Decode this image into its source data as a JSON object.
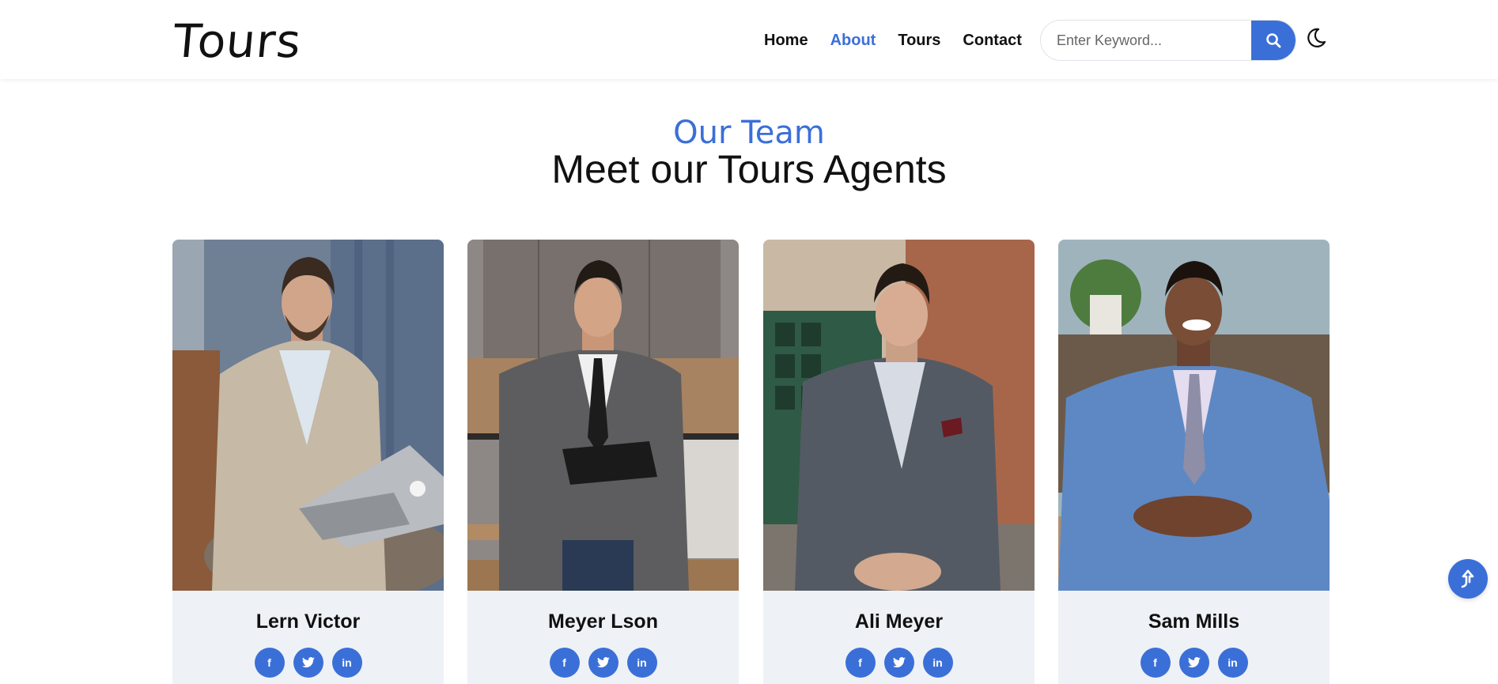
{
  "brand": {
    "logo": "Tours"
  },
  "nav": {
    "items": [
      {
        "label": "Home",
        "active": false
      },
      {
        "label": "About",
        "active": true
      },
      {
        "label": "Tours",
        "active": false
      },
      {
        "label": "Contact",
        "active": false
      }
    ]
  },
  "search": {
    "placeholder": "Enter Keyword...",
    "value": "",
    "icon": "search-icon"
  },
  "theme_toggle": {
    "icon": "moon-icon"
  },
  "section": {
    "eyebrow": "Our Team",
    "title": "Meet our Tours Agents"
  },
  "agents": [
    {
      "name": "Lern Victor",
      "socials": [
        "f",
        "twitter",
        "in"
      ]
    },
    {
      "name": "Meyer Lson",
      "socials": [
        "f",
        "twitter",
        "in"
      ]
    },
    {
      "name": "Ali Meyer",
      "socials": [
        "f",
        "twitter",
        "in"
      ]
    },
    {
      "name": "Sam Mills",
      "socials": [
        "f",
        "twitter",
        "in"
      ]
    }
  ],
  "scroll_top": {
    "icon": "arrow-up-icon"
  },
  "colors": {
    "accent": "#3b6fd8",
    "card_bg": "#eef2f6",
    "text": "#111111"
  }
}
